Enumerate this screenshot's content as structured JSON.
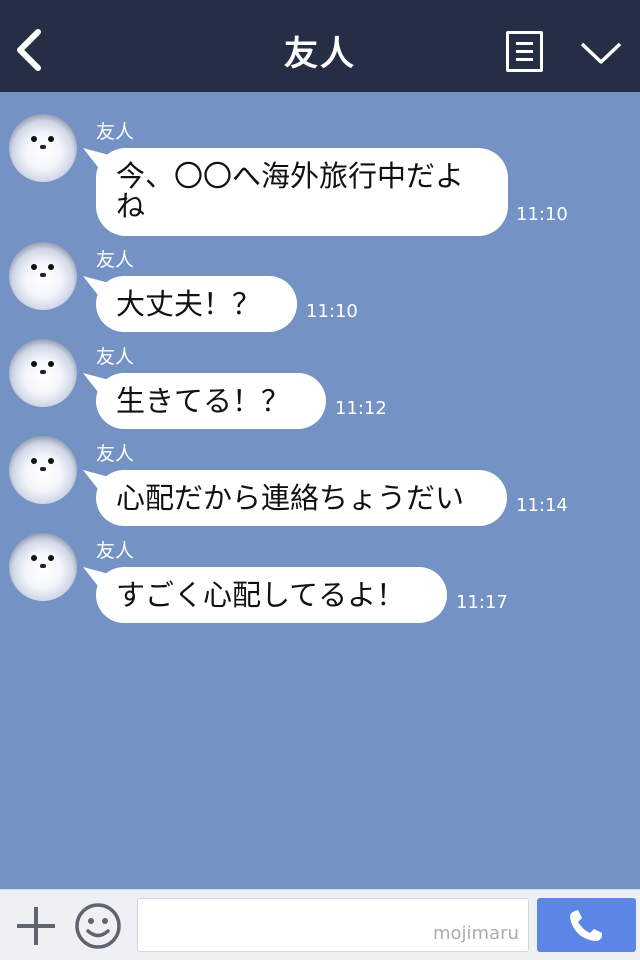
{
  "header": {
    "title": "友人",
    "back_icon": "chevron-left-icon",
    "menu_icon": "notes-icon",
    "dropdown_icon": "chevron-down-icon"
  },
  "messages": [
    {
      "sender": "友人",
      "text": "今、〇〇へ海外旅行中だよね",
      "time": "11:10"
    },
    {
      "sender": "友人",
      "text": "大丈夫！？",
      "time": "11:10"
    },
    {
      "sender": "友人",
      "text": "生きてる！？",
      "time": "11:12"
    },
    {
      "sender": "友人",
      "text": "心配だから連絡ちょうだい",
      "time": "11:14"
    },
    {
      "sender": "友人",
      "text": "すごく心配してるよ！",
      "time": "11:17"
    }
  ],
  "footer": {
    "input_value": "",
    "watermark": "mojimaru",
    "plus_icon": "plus-icon",
    "emoji_icon": "smiley-icon",
    "call_icon": "phone-icon"
  },
  "colors": {
    "header_bg": "#262e45",
    "chat_bg": "#7493c4",
    "call_button": "#5b86e6"
  }
}
